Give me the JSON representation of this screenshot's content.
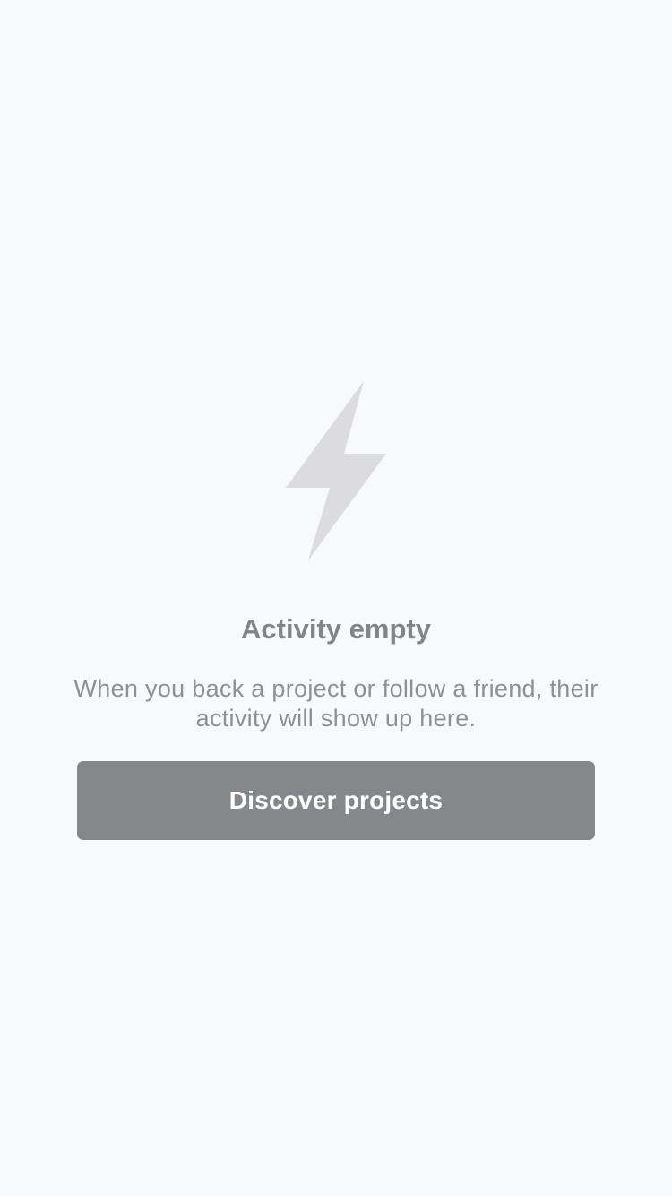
{
  "empty_state": {
    "icon": "lightning-bolt-icon",
    "icon_color": "#dcdbdf",
    "title": "Activity empty",
    "message": "When you back a project or follow a friend, their activity will show up here."
  },
  "actions": {
    "discover_label": "Discover projects"
  },
  "colors": {
    "background": "#f7f9fa",
    "button": "#85888a",
    "title_text": "#828486",
    "message_text": "#8e9093"
  }
}
